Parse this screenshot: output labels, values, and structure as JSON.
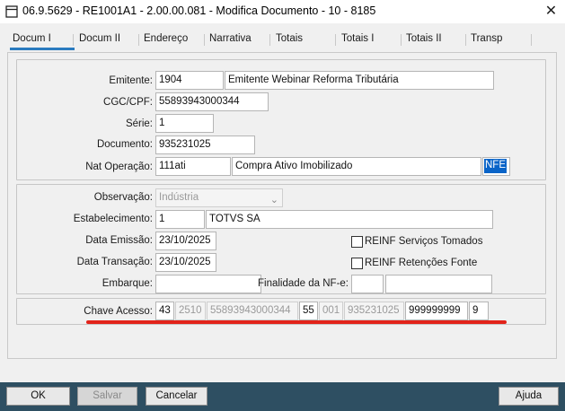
{
  "window": {
    "title": "06.9.5629 - RE1001A1 - 2.00.00.081 - Modifica Documento - 10 - 8185",
    "close_glyph": "✕"
  },
  "tabs": [
    {
      "label": "Docum I",
      "active": true
    },
    {
      "label": "Docum II"
    },
    {
      "label": "Endereço"
    },
    {
      "label": "Narrativa"
    },
    {
      "label": "Totais"
    },
    {
      "label": "Totais I"
    },
    {
      "label": "Totais II"
    },
    {
      "label": "Transp"
    }
  ],
  "header_group": {
    "emitente_label": "Emitente:",
    "emitente_code": "1904",
    "emitente_name": "Emitente Webinar Reforma Tributária",
    "cgc_label": "CGC/CPF:",
    "cgc_value": "55893943000344",
    "serie_label": "Série:",
    "serie_value": "1",
    "documento_label": "Documento:",
    "documento_value": "935231025",
    "natop_label": "Nat Operação:",
    "natop_code": "111ati",
    "natop_desc": "Compra Ativo Imobilizado",
    "natop_type": "NFE"
  },
  "detail_group": {
    "observacao_label": "Observação:",
    "observacao_value": "Indústria",
    "estab_label": "Estabelecimento:",
    "estab_code": "1",
    "estab_name": "TOTVS SA",
    "data_emissao_label": "Data Emissão:",
    "data_emissao_value": "23/10/2025",
    "data_transacao_label": "Data Transação:",
    "data_transacao_value": "23/10/2025",
    "embarque_label": "Embarque:",
    "embarque_value": "",
    "finalidade_label": "Finalidade da NF-e:",
    "finalidade_code": "",
    "finalidade_desc": "",
    "reinf_servicos_label": "REINF Serviços Tomados",
    "reinf_servicos_checked": false,
    "reinf_retencoes_label": "REINF Retenções Fonte",
    "reinf_retencoes_checked": false
  },
  "chave_group": {
    "label": "Chave Acesso:",
    "uf": "43",
    "aamm": "2510",
    "cnpj": "55893943000344",
    "modelo": "55",
    "serie": "001",
    "numero": "935231025",
    "tpemis_codigo": "999999999",
    "dv": "9"
  },
  "buttons": {
    "ok": "OK",
    "salvar": "Salvar",
    "cancelar": "Cancelar",
    "ajuda": "Ajuda"
  },
  "colors": {
    "bottom_bar": "#2e4f62",
    "tab_active_underline": "#2a7bbf",
    "highlight_line": "#e2231a",
    "selection": "#0a64c8"
  }
}
